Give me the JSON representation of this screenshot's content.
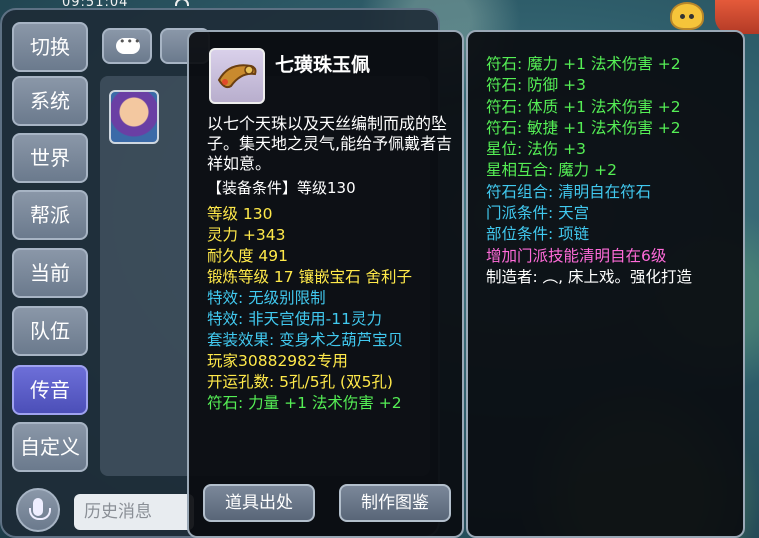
{
  "status_bar": {
    "time": "09:51:04"
  },
  "chat": {
    "channels": [
      {
        "label": "切换"
      },
      {
        "label": "系统"
      },
      {
        "label": "世界"
      },
      {
        "label": "帮派"
      },
      {
        "label": "当前"
      },
      {
        "label": "队伍"
      },
      {
        "label": "传音"
      },
      {
        "label": "自定义"
      }
    ],
    "active_channel": "传音",
    "history_placeholder": "历史消息"
  },
  "item": {
    "name": "七璜珠玉佩",
    "description": "以七个天珠以及天丝编制而成的坠子。集天地之灵气,能给予佩戴者吉祥如意。",
    "requirement": "【装备条件】等级130",
    "stats": [
      {
        "text": "等级 130",
        "color": "yellow"
      },
      {
        "text": "灵力 +343",
        "color": "yellow"
      },
      {
        "text": "耐久度 491",
        "color": "yellow"
      },
      {
        "text": "锻炼等级 17  镶嵌宝石 舍利子",
        "color": "yellow"
      },
      {
        "text": "特效: 无级别限制",
        "color": "cyan"
      },
      {
        "text": "特效: 非天宫使用-11灵力",
        "color": "cyan"
      },
      {
        "text": "套装效果: 变身术之葫芦宝贝",
        "color": "cyan"
      },
      {
        "text": "玩家30882982专用",
        "color": "yellow"
      },
      {
        "text": "开运孔数: 5孔/5孔 (双5孔)",
        "color": "yellow"
      },
      {
        "text": "符石: 力量 +1 法术伤害 +2",
        "color": "green"
      }
    ],
    "buttons": {
      "source": "道具出处",
      "catalog": "制作图鉴"
    }
  },
  "attributes": [
    {
      "text": "符石: 魔力 +1 法术伤害 +2",
      "color": "green"
    },
    {
      "text": "符石: 防御 +3",
      "color": "green"
    },
    {
      "text": "符石: 体质 +1 法术伤害 +2",
      "color": "green"
    },
    {
      "text": "符石: 敏捷 +1 法术伤害 +2",
      "color": "green"
    },
    {
      "text": "星位: 法伤 +3",
      "color": "green"
    },
    {
      "text": "星相互合: 魔力 +2",
      "color": "green"
    },
    {
      "text": "符石组合: 清明自在符石",
      "color": "cyan"
    },
    {
      "text": "门派条件: 天宫",
      "color": "cyan"
    },
    {
      "text": "部位条件: 项链",
      "color": "cyan"
    },
    {
      "text": "增加门派技能清明自在6级",
      "color": "magenta"
    },
    {
      "text": "制造者: ︵, 床上戏。强化打造",
      "color": "white"
    }
  ],
  "colors": {
    "yellow": "#ffe94a",
    "cyan": "#41c9ef",
    "green": "#55ef55",
    "magenta": "#ff6bd9",
    "white": "#ffffff",
    "active_channel": "#5a5cc8"
  },
  "icons": [
    "chat-bubble-icon",
    "mic-icon",
    "wifi-icon",
    "cat-face-icon",
    "jade-pendant-icon"
  ]
}
